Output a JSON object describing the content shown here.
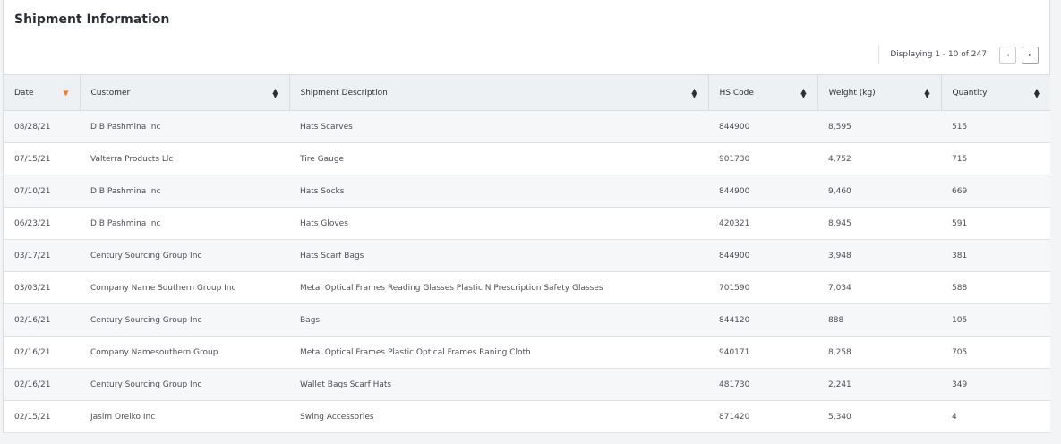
{
  "title": "Shipment Information",
  "pager": {
    "text": "Displaying 1 - 10 of 247",
    "prev_icon": "◂",
    "next_icon": "▸"
  },
  "columns": [
    {
      "key": "date",
      "label": "Date"
    },
    {
      "key": "customer",
      "label": "Customer"
    },
    {
      "key": "description",
      "label": "Shipment Description"
    },
    {
      "key": "hs_code",
      "label": "HS Code"
    },
    {
      "key": "weight",
      "label": "Weight (kg)"
    },
    {
      "key": "quantity",
      "label": "Quantity"
    }
  ],
  "sort": {
    "column": "date",
    "direction": "desc",
    "active_color": "#f47b20"
  },
  "rows": [
    {
      "date": "08/28/21",
      "customer": "D B Pashmina Inc",
      "description": "Hats Scarves",
      "hs_code": "844900",
      "weight": "8,595",
      "quantity": "515"
    },
    {
      "date": "07/15/21",
      "customer": "Valterra Products Llc",
      "description": "Tire Gauge",
      "hs_code": "901730",
      "weight": "4,752",
      "quantity": "715"
    },
    {
      "date": "07/10/21",
      "customer": "D B Pashmina Inc",
      "description": "Hats Socks",
      "hs_code": "844900",
      "weight": "9,460",
      "quantity": "669"
    },
    {
      "date": "06/23/21",
      "customer": "D B Pashmina Inc",
      "description": "Hats Gloves",
      "hs_code": "420321",
      "weight": "8,945",
      "quantity": "591"
    },
    {
      "date": "03/17/21",
      "customer": "Century Sourcing Group Inc",
      "description": "Hats Scarf Bags",
      "hs_code": "844900",
      "weight": "3,948",
      "quantity": "381"
    },
    {
      "date": "03/03/21",
      "customer": "Company Name Southern Group Inc",
      "description": "Metal Optical Frames Reading Glasses Plastic N Prescription Safety Glasses",
      "hs_code": "701590",
      "weight": "7,034",
      "quantity": "588"
    },
    {
      "date": "02/16/21",
      "customer": "Century Sourcing Group Inc",
      "description": "Bags",
      "hs_code": "844120",
      "weight": "888",
      "quantity": "105"
    },
    {
      "date": "02/16/21",
      "customer": "Company Namesouthern Group",
      "description": "Metal Optical Frames Plastic Optical Frames Raning Cloth",
      "hs_code": "940171",
      "weight": "8,258",
      "quantity": "705"
    },
    {
      "date": "02/16/21",
      "customer": "Century Sourcing Group Inc",
      "description": "Wallet Bags Scarf Hats",
      "hs_code": "481730",
      "weight": "2,241",
      "quantity": "349"
    },
    {
      "date": "02/15/21",
      "customer": "Jasim Orelko Inc",
      "description": "Swing Accessories",
      "hs_code": "871420",
      "weight": "5,340",
      "quantity": "4"
    }
  ]
}
